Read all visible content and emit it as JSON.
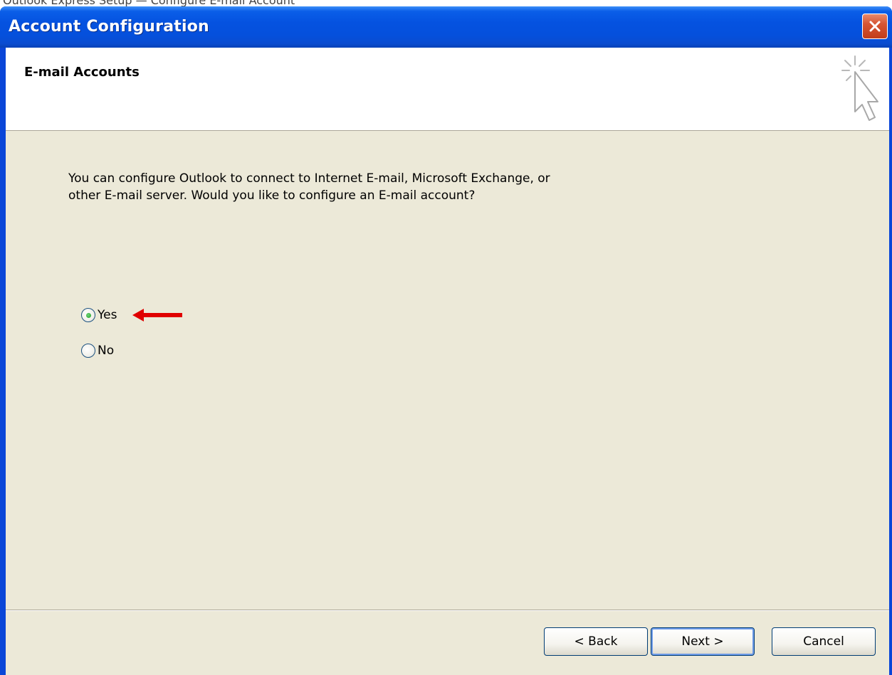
{
  "top_caption": "Outlook Express Setup — Configure E-mail Account",
  "window": {
    "title": "Account Configuration",
    "close_icon": "close-icon"
  },
  "header": {
    "title": "E-mail Accounts",
    "icon": "wizard-sparkle-cursor-icon"
  },
  "body": {
    "intro_line1": "You can configure Outlook to connect to Internet E-mail, Microsoft Exchange, or",
    "intro_line2": "other E-mail server. Would you like to configure an E-mail account?",
    "options": [
      {
        "label": "Yes",
        "selected": true
      },
      {
        "label": "No",
        "selected": false
      }
    ],
    "annotation": {
      "icon": "red-arrow-icon",
      "color": "#e00000"
    }
  },
  "buttons": {
    "back": "< Back",
    "next": "Next >",
    "cancel": "Cancel"
  },
  "colors": {
    "titlebar": "#0552e0",
    "dialog_bg": "#ece9d8",
    "close_button": "#d65533",
    "radio_dot": "#21a121"
  }
}
